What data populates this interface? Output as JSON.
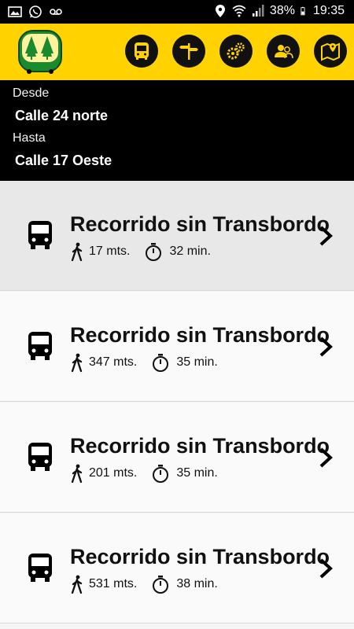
{
  "status_bar": {
    "battery": "38%",
    "time": "19:35",
    "icons": [
      "image-icon",
      "whatsapp-icon",
      "voicemail-icon",
      "location-icon",
      "wifi-icon",
      "signal-icon",
      "battery-icon"
    ]
  },
  "header": {
    "logo": "bus-trees-logo-icon",
    "tools": [
      "bus-icon",
      "signpost-icon",
      "gears-icon",
      "users-icon",
      "map-pin-icon"
    ]
  },
  "route": {
    "from_label": "Desde",
    "from_value": "Calle 24 norte",
    "to_label": "Hasta",
    "to_value": "Calle 17 Oeste"
  },
  "results": [
    {
      "title": "Recorrido sin Transbordo",
      "walk": "17 mts.",
      "time": "32 min.",
      "selected": true
    },
    {
      "title": "Recorrido sin Transbordo",
      "walk": "347 mts.",
      "time": "35 min.",
      "selected": false
    },
    {
      "title": "Recorrido sin Transbordo",
      "walk": "201 mts.",
      "time": "35 min.",
      "selected": false
    },
    {
      "title": "Recorrido sin Transbordo",
      "walk": "531 mts.",
      "time": "38 min.",
      "selected": false
    }
  ],
  "colors": {
    "header_yellow": "#ffd200",
    "route_bg": "#000000",
    "list_bg": "#fafafa",
    "selected_bg": "#e8e8e8",
    "logo_green": "#1a8a2e"
  }
}
